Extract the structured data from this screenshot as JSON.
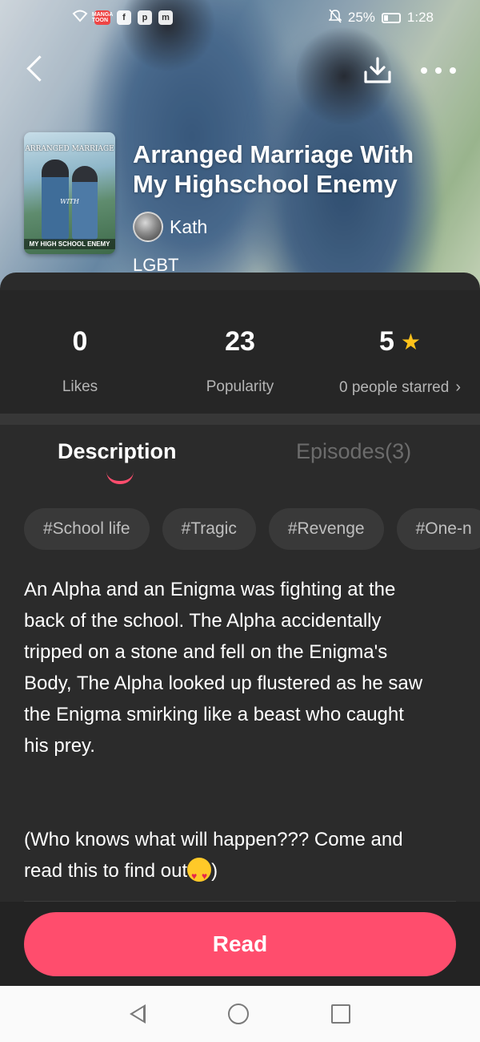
{
  "status_bar": {
    "icons": [
      "wifi-icon",
      "manga-toon-icon",
      "facebook-icon",
      "pinterest-icon",
      "messenger-icon"
    ],
    "app_badge": "MANGA TOON",
    "battery_percent": "25%",
    "time": "1:28"
  },
  "header": {
    "back_icon": "chevron-left-icon",
    "download_icon": "download-icon",
    "more_icon": "more-dots-icon"
  },
  "book": {
    "cover": {
      "top_text": "ARRANGED MARRIAGE",
      "mid_text": "WITH",
      "bottom_text": "MY HIGH SCHOOL ENEMY"
    },
    "title": "Arranged Marriage With My Highschool Enemy",
    "author": "Kath",
    "genre": "LGBT"
  },
  "stats": [
    {
      "value": "0",
      "label": "Likes"
    },
    {
      "value": "23",
      "label": "Popularity"
    },
    {
      "value": "5",
      "label": "0 people starred",
      "icon": "star-icon"
    }
  ],
  "tabs": [
    {
      "label": "Description",
      "active": true
    },
    {
      "label": "Episodes(3)",
      "active": false
    }
  ],
  "tags": [
    "#School life",
    "#Tragic",
    "#Revenge",
    "#One-n"
  ],
  "description": {
    "paragraph1": "An Alpha and an Enigma was fighting at the back of the school. The Alpha accidentally tripped on a stone and fell on the Enigma's Body, The Alpha looked up flustered as he saw the Enigma smirking like a beast who caught his prey.",
    "paragraph2_before": "(Who knows what will happen??? Come and read this to find out",
    "paragraph2_after": ")"
  },
  "read_button": "Read",
  "colors": {
    "accent": "#ff4d6d",
    "star": "#ffc21a",
    "background": "#2b2b2b"
  }
}
